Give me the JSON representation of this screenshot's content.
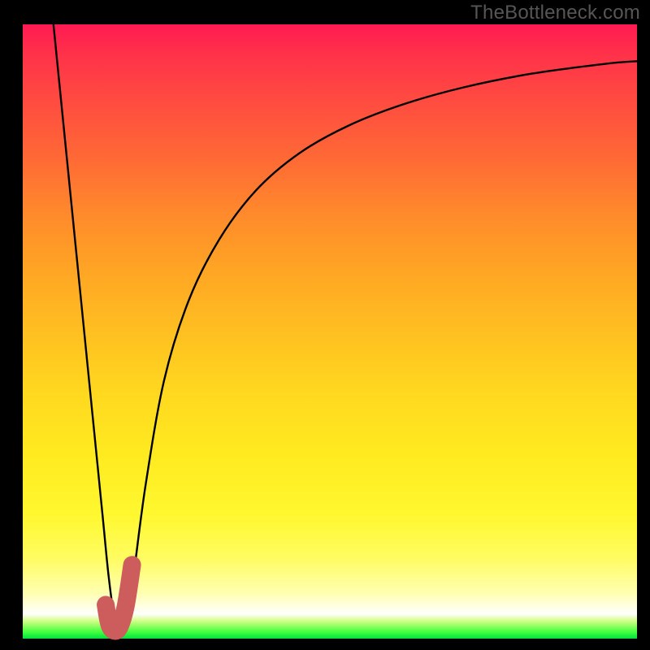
{
  "watermark": {
    "text": "TheBottleneck.com"
  },
  "chart_data": {
    "type": "line",
    "title": "",
    "xlabel": "",
    "ylabel": "",
    "xlim": [
      0,
      100
    ],
    "ylim": [
      0,
      100
    ],
    "grid": false,
    "legend": false,
    "background_gradient": {
      "orientation": "vertical",
      "stops": [
        {
          "pos": 0.0,
          "color": "#ff1a53"
        },
        {
          "pos": 0.13,
          "color": "#ff4d40"
        },
        {
          "pos": 0.31,
          "color": "#ff8a2c"
        },
        {
          "pos": 0.5,
          "color": "#ffbf21"
        },
        {
          "pos": 0.7,
          "color": "#ffea20"
        },
        {
          "pos": 0.87,
          "color": "#fffc62"
        },
        {
          "pos": 0.96,
          "color": "#ffffff"
        },
        {
          "pos": 0.99,
          "color": "#3cff3c"
        },
        {
          "pos": 1.0,
          "color": "#00e040"
        }
      ]
    },
    "series": [
      {
        "name": "bottleneck_curve",
        "stroke": "#000000",
        "stroke_width": 2.4,
        "x": [
          5,
          7,
          9,
          11,
          13,
          14,
          15,
          16,
          17,
          18,
          20,
          23,
          27,
          32,
          38,
          45,
          53,
          62,
          72,
          83,
          95,
          100
        ],
        "y": [
          100,
          80,
          60,
          40,
          20,
          10,
          3,
          2,
          4,
          10,
          25,
          42,
          55,
          65,
          73,
          79,
          83.5,
          87,
          89.8,
          92,
          93.6,
          94
        ]
      },
      {
        "name": "optimal_marker",
        "stroke": "#cd5c5c",
        "stroke_width": 22,
        "x": [
          13.5,
          14.2,
          15.5,
          16.7,
          17.8
        ],
        "y": [
          5.5,
          2.0,
          1.5,
          5.0,
          12.0
        ]
      }
    ],
    "annotations": []
  }
}
